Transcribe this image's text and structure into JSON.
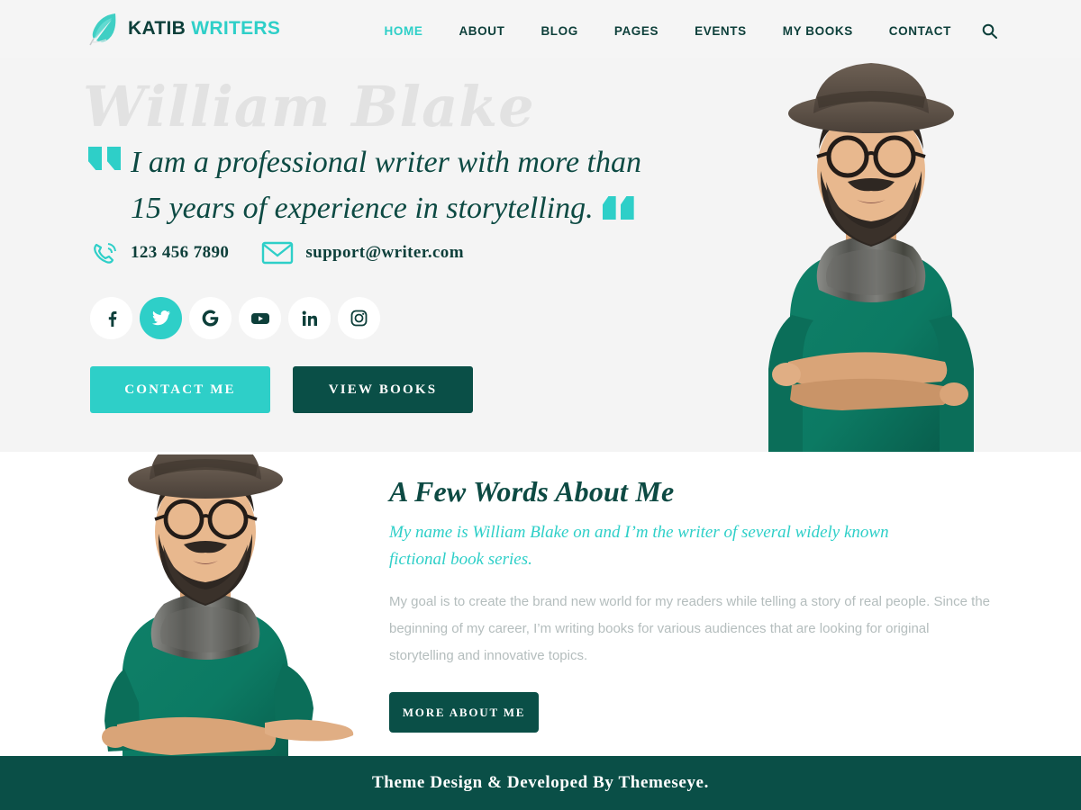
{
  "header": {
    "logo": {
      "icon": "quill-feather-icon",
      "primary": "KATIB",
      "secondary": "WRITERS"
    },
    "nav": [
      {
        "label": "HOME",
        "active": true
      },
      {
        "label": "ABOUT",
        "active": false
      },
      {
        "label": "BLOG",
        "active": false
      },
      {
        "label": "PAGES",
        "active": false
      },
      {
        "label": "EVENTS",
        "active": false
      },
      {
        "label": "MY BOOKS",
        "active": false
      },
      {
        "label": "CONTACT",
        "active": false
      }
    ],
    "search_icon": "search-icon"
  },
  "hero": {
    "name": "William Blake",
    "quote_line1": "I am a professional writer with more than",
    "quote_line2": "15 years of experience in storytelling.",
    "phone": "123 456 7890",
    "phone_icon": "phone-icon",
    "email": "support@writer.com",
    "email_icon": "envelope-icon",
    "socials": [
      {
        "name": "facebook",
        "glyph": "f",
        "active": false
      },
      {
        "name": "twitter",
        "glyph": "bird",
        "active": true
      },
      {
        "name": "google",
        "glyph": "G",
        "active": false
      },
      {
        "name": "youtube",
        "glyph": "play",
        "active": false
      },
      {
        "name": "linkedin",
        "glyph": "in",
        "active": false
      },
      {
        "name": "instagram",
        "glyph": "camera",
        "active": false
      }
    ],
    "btn_contact": "CONTACT ME",
    "btn_books": "VIEW BOOKS",
    "portrait_alt": "bearded-man-with-hat-portrait"
  },
  "about": {
    "title": "A Few Words About Me",
    "subtitle": "My name is William Blake on and I’m the writer of several  widely known fictional book series.",
    "paragraph": "My goal is to create the brand new world for my readers while telling a story of real people. Since the beginning of my career, I’m writing books for various audiences that are looking for original storytelling and innovative topics.",
    "button": "MORE ABOUT ME",
    "portrait_alt": "bearded-man-presenting-gesture"
  },
  "footer": {
    "text": "Theme Design & Developed By Themeseye."
  },
  "colors": {
    "teal": "#2ecfc8",
    "dark_teal": "#0a4f47",
    "heading_teal": "#0d4a43",
    "hero_bg": "#f4f4f4",
    "body_text": "#b4bdbd",
    "watermark": "#e2e2e2"
  }
}
